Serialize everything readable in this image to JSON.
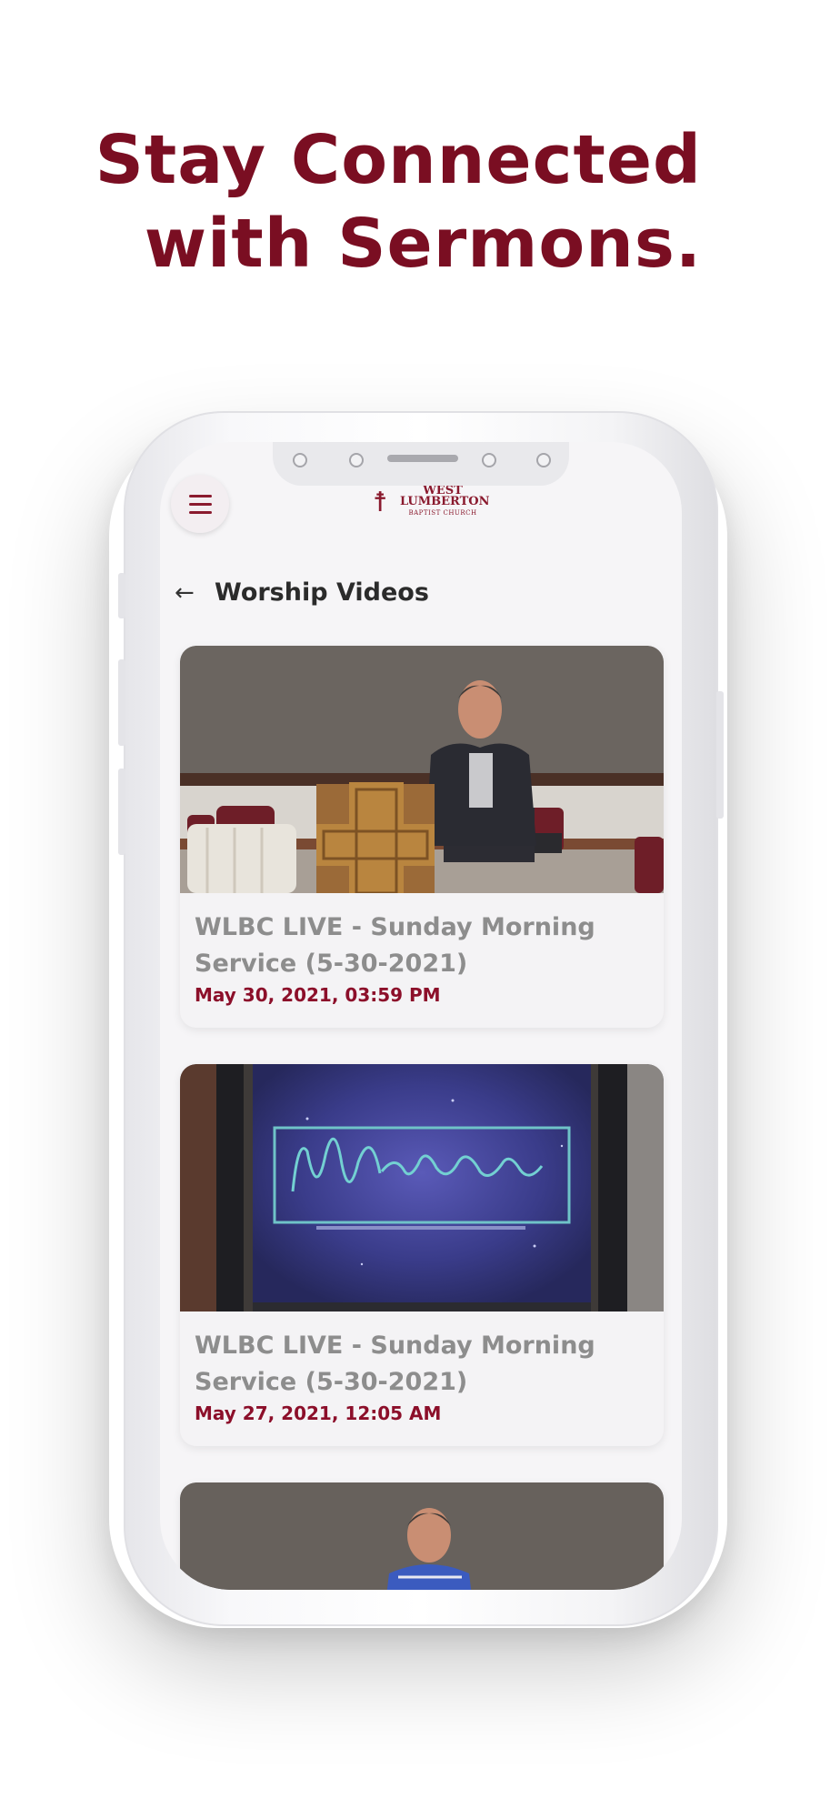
{
  "promo": {
    "headline_line1": "Stay Connected",
    "headline_line2": "with Sermons."
  },
  "colors": {
    "brand": "#7a0e22",
    "date": "#8c0f2a",
    "title_text": "#8d8d8d"
  },
  "app": {
    "logo": {
      "line1": "WEST",
      "line2": "LUMBERTON",
      "line3": "BAPTIST CHURCH"
    },
    "menu_icon": "hamburger-menu-icon",
    "back_icon": "arrow-left-icon",
    "page_title": "Worship Videos",
    "videos": [
      {
        "title": "WLBC LIVE - Sunday Morning Service (5-30-2021)",
        "date": "May 30, 2021, 03:59 PM"
      },
      {
        "title": "WLBC LIVE - Sunday Morning Service (5-30-2021)",
        "date": "May 27, 2021, 12:05 AM"
      }
    ]
  }
}
